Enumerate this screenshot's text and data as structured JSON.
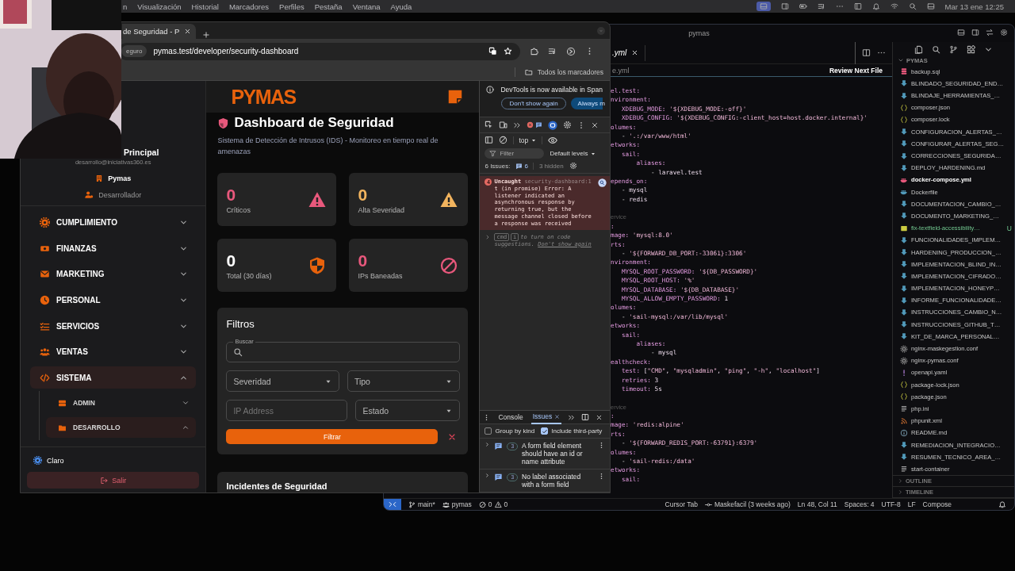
{
  "menu_bar": {
    "items": [
      "n",
      "Visualización",
      "Historial",
      "Marcadores",
      "Perfiles",
      "Pestaña",
      "Ventana",
      "Ayuda"
    ],
    "clock": "Mar 13 ene 12:25"
  },
  "browser": {
    "tab": {
      "title": "de Seguridad - P",
      "selected": true
    },
    "address_chip": "eguro",
    "url": "pymas.test/developer/security-dashboard",
    "bookmarks_folder": "Todos los marcadores"
  },
  "app": {
    "logo": "PYMAS",
    "user": {
      "name": "Principal",
      "email": "desarrollo@iniciativas360.es",
      "company": "Pymas",
      "role": "Desarrollador"
    },
    "nav": [
      {
        "label": "CUMPLIMIENTO",
        "expanded": false,
        "selected": false
      },
      {
        "label": "FINANZAS",
        "expanded": false,
        "selected": false
      },
      {
        "label": "MARKETING",
        "expanded": false,
        "selected": false
      },
      {
        "label": "PERSONAL",
        "expanded": false,
        "selected": false
      },
      {
        "label": "SERVICIOS",
        "expanded": false,
        "selected": false
      },
      {
        "label": "VENTAS",
        "expanded": false,
        "selected": false
      },
      {
        "label": "SISTEMA",
        "expanded": true,
        "selected": true,
        "children": [
          {
            "label": "ADMIN",
            "expanded": false,
            "selected": false
          },
          {
            "label": "DESARROLLO",
            "expanded": true,
            "selected": true
          }
        ]
      }
    ],
    "theme_toggle": "Claro",
    "logout": "Salir",
    "page": {
      "title": "Dashboard de Seguridad",
      "subtitle": "Sistema de Detección de Intrusos (IDS) - Monitoreo en tiempo real de amenazas",
      "stats": [
        {
          "value": "0",
          "label": "Críticos",
          "color": "#e8587c"
        },
        {
          "value": "0",
          "label": "Alta Severidad",
          "color": "#f2b45e"
        },
        {
          "value": "0",
          "label": "Total (30 días)",
          "color": "#ffffff"
        },
        {
          "value": "0",
          "label": "IPs Baneadas",
          "color": "#e8587c"
        }
      ],
      "filters": {
        "title": "Filtros",
        "fields": [
          {
            "kind": "search",
            "label": "Buscar"
          },
          {
            "kind": "select",
            "placeholder": "Severidad"
          },
          {
            "kind": "select",
            "placeholder": "Tipo"
          },
          {
            "kind": "text",
            "placeholder": "IP Address"
          },
          {
            "kind": "select",
            "placeholder": "Estado"
          }
        ],
        "apply": "Filtrar"
      },
      "incidents_title": "Incidentes de Seguridad"
    }
  },
  "devtools": {
    "banner": {
      "text": "DevTools is now available in Span",
      "dismiss": "Don't show again",
      "accept": "Always m"
    },
    "context": "top",
    "filter_placeholder": "Filter",
    "levels": "Default levels",
    "issues_label": "6 Issues:",
    "issues_count": "6",
    "hidden": "3 hidden",
    "messages": [
      {
        "count": "4",
        "head": "Uncaught",
        "source": "security-dashboard:1",
        "text": "t (in promise) Error: A listener indicated an asynchronous response by returning true, but the message channel closed before a response was received"
      }
    ],
    "hint": {
      "keys": [
        "cmd",
        "i"
      ],
      "text": "to turn on code suggestions.",
      "link": "Don't show again"
    },
    "drawer_tabs": [
      {
        "label": "Console",
        "selected": false
      },
      {
        "label": "Issues",
        "selected": true
      }
    ],
    "options": [
      {
        "label": "Group by kind",
        "checked": false
      },
      {
        "label": "Include third-party",
        "checked": true
      }
    ],
    "issues": [
      {
        "count": "3",
        "text": "A form field element should have an id or name attribute"
      },
      {
        "count": "3",
        "text": "No label associated with a form field"
      }
    ]
  },
  "vscode": {
    "title": "pymas",
    "tab": {
      "label": ".yml",
      "selected": true
    },
    "breadcrumb": "e.yml",
    "review": "Review Next File",
    "code": [
      {
        "kind": "code",
        "text": "el.test:"
      },
      {
        "kind": "code",
        "text": "nvironment:"
      },
      {
        "kind": "code",
        "text": "   XDEBUG_MODE: '${XDEBUG_MODE:-off}'"
      },
      {
        "kind": "code",
        "text": "   XDEBUG_CONFIG: '${XDEBUG_CONFIG:-client_host=host.docker.internal}'"
      },
      {
        "kind": "code",
        "text": "olumes:"
      },
      {
        "kind": "code",
        "text": "   - '.:/var/www/html'"
      },
      {
        "kind": "code",
        "text": "etworks:"
      },
      {
        "kind": "code",
        "text": "   sail:"
      },
      {
        "kind": "code",
        "text": "       aliases:"
      },
      {
        "kind": "code",
        "text": "           - laravel.test"
      },
      {
        "kind": "code",
        "text": "epends_on:"
      },
      {
        "kind": "code",
        "text": "   - mysql"
      },
      {
        "kind": "code",
        "text": "   - redis"
      },
      {
        "kind": "codelens",
        "text": "ervice"
      },
      {
        "kind": "code",
        "text": ":"
      },
      {
        "kind": "code",
        "text": "mage: 'mysql:8.0'"
      },
      {
        "kind": "code",
        "text": "rts:"
      },
      {
        "kind": "code",
        "text": "   - '${FORWARD_DB_PORT:-33061}:3306'"
      },
      {
        "kind": "code",
        "text": "nvironment:"
      },
      {
        "kind": "code",
        "text": "   MYSQL_ROOT_PASSWORD: '${DB_PASSWORD}'"
      },
      {
        "kind": "code",
        "text": "   MYSQL_ROOT_HOST: '%'"
      },
      {
        "kind": "code",
        "text": "   MYSQL_DATABASE: '${DB_DATABASE}'"
      },
      {
        "kind": "code",
        "text": "   MYSQL_ALLOW_EMPTY_PASSWORD: 1"
      },
      {
        "kind": "code",
        "text": "olumes:"
      },
      {
        "kind": "code",
        "text": "   - 'sail-mysql:/var/lib/mysql'"
      },
      {
        "kind": "code",
        "text": "etworks:"
      },
      {
        "kind": "code",
        "text": "   sail:"
      },
      {
        "kind": "code",
        "text": "       aliases:"
      },
      {
        "kind": "code",
        "text": "           - mysql"
      },
      {
        "kind": "code",
        "text": "ealthcheck:"
      },
      {
        "kind": "code",
        "text": "   test: [\"CMD\", \"mysqladmin\", \"ping\", \"-h\", \"localhost\"]"
      },
      {
        "kind": "code",
        "text": "   retries: 3"
      },
      {
        "kind": "code",
        "text": "   timeout: 5s"
      },
      {
        "kind": "codelens",
        "text": "ervice"
      },
      {
        "kind": "code",
        "text": ":"
      },
      {
        "kind": "code",
        "text": "mage: 'redis:alpine'"
      },
      {
        "kind": "code",
        "text": "rts:"
      },
      {
        "kind": "code",
        "text": "   - '${FORWARD_REDIS_PORT:-63791}:6379'"
      },
      {
        "kind": "code",
        "text": "olumes:"
      },
      {
        "kind": "code",
        "text": "   - 'sail-redis:/data'"
      },
      {
        "kind": "code",
        "text": "etworks:"
      },
      {
        "kind": "code",
        "text": "   sail:"
      }
    ],
    "explorer": {
      "root": "PYMAS",
      "files": [
        {
          "name": "backup.sql",
          "kind": "db",
          "selected": false
        },
        {
          "name": "BLINDADO_SEGURIDAD_END…",
          "kind": "md",
          "selected": false
        },
        {
          "name": "BLINDAJE_HERRAMIENTAS_…",
          "kind": "md",
          "selected": false
        },
        {
          "name": "composer.json",
          "kind": "json",
          "selected": false
        },
        {
          "name": "composer.lock",
          "kind": "json",
          "selected": false
        },
        {
          "name": "CONFIGURACION_ALERTAS_…",
          "kind": "md",
          "selected": false
        },
        {
          "name": "CONFIGURAR_ALERTAS_SEG…",
          "kind": "md",
          "selected": false
        },
        {
          "name": "CORRECCIONES_SEGURIDA…",
          "kind": "md",
          "selected": false
        },
        {
          "name": "DEPLOY_HARDENING.md",
          "kind": "md",
          "selected": false
        },
        {
          "name": "docker-compose.yml",
          "kind": "compose",
          "selected": true
        },
        {
          "name": "Dockerfile",
          "kind": "docker",
          "selected": false
        },
        {
          "name": "DOCUMENTACION_CAMBIO_…",
          "kind": "md",
          "selected": false
        },
        {
          "name": "DOCUMENTO_MARKETING_…",
          "kind": "md",
          "selected": false
        },
        {
          "name": "fix-textfield-accessibility…",
          "kind": "js",
          "selected": false,
          "git_status": "U"
        },
        {
          "name": "FUNCIONALIDADES_IMPLEM…",
          "kind": "md",
          "selected": false
        },
        {
          "name": "HARDENING_PRODUCCION_…",
          "kind": "md",
          "selected": false
        },
        {
          "name": "IMPLEMENTACION_BLIND_IN…",
          "kind": "md",
          "selected": false
        },
        {
          "name": "IMPLEMENTACION_CIFRADO…",
          "kind": "md",
          "selected": false
        },
        {
          "name": "IMPLEMENTACION_HONEYP…",
          "kind": "md",
          "selected": false
        },
        {
          "name": "INFORME_FUNCIONALIDADE…",
          "kind": "md",
          "selected": false
        },
        {
          "name": "INSTRUCCIONES_CAMBIO_N…",
          "kind": "md",
          "selected": false
        },
        {
          "name": "INSTRUCCIONES_GITHUB_T…",
          "kind": "md",
          "selected": false
        },
        {
          "name": "KIT_DE_MARCA_PERSONAL…",
          "kind": "md",
          "selected": false
        },
        {
          "name": "nginx-maskegestion.conf",
          "kind": "conf",
          "selected": false
        },
        {
          "name": "nginx-pymas.conf",
          "kind": "conf",
          "selected": false
        },
        {
          "name": "openapi.yaml",
          "kind": "yaml",
          "selected": false
        },
        {
          "name": "package-lock.json",
          "kind": "json",
          "selected": false
        },
        {
          "name": "package.json",
          "kind": "json",
          "selected": false
        },
        {
          "name": "php.ini",
          "kind": "ini",
          "selected": false
        },
        {
          "name": "phpunit.xml",
          "kind": "xml",
          "selected": false
        },
        {
          "name": "README.md",
          "kind": "info",
          "selected": false
        },
        {
          "name": "REMEDIACION_INTEGRACIO…",
          "kind": "md",
          "selected": false
        },
        {
          "name": "RESUMEN_TECNICO_AREA_…",
          "kind": "md",
          "selected": false
        },
        {
          "name": "start-container",
          "kind": "ini",
          "selected": false
        }
      ]
    },
    "panels": [
      "OUTLINE",
      "TIMELINE"
    ],
    "status": {
      "branch": "main*",
      "project": "pymas",
      "errors": "0",
      "warnings": "0",
      "right": [
        "Cursor Tab",
        "Maskefacil (3 weeks ago)",
        "Ln 48, Col 11",
        "Spaces: 4",
        "UTF-8",
        "LF",
        "Compose"
      ]
    }
  }
}
